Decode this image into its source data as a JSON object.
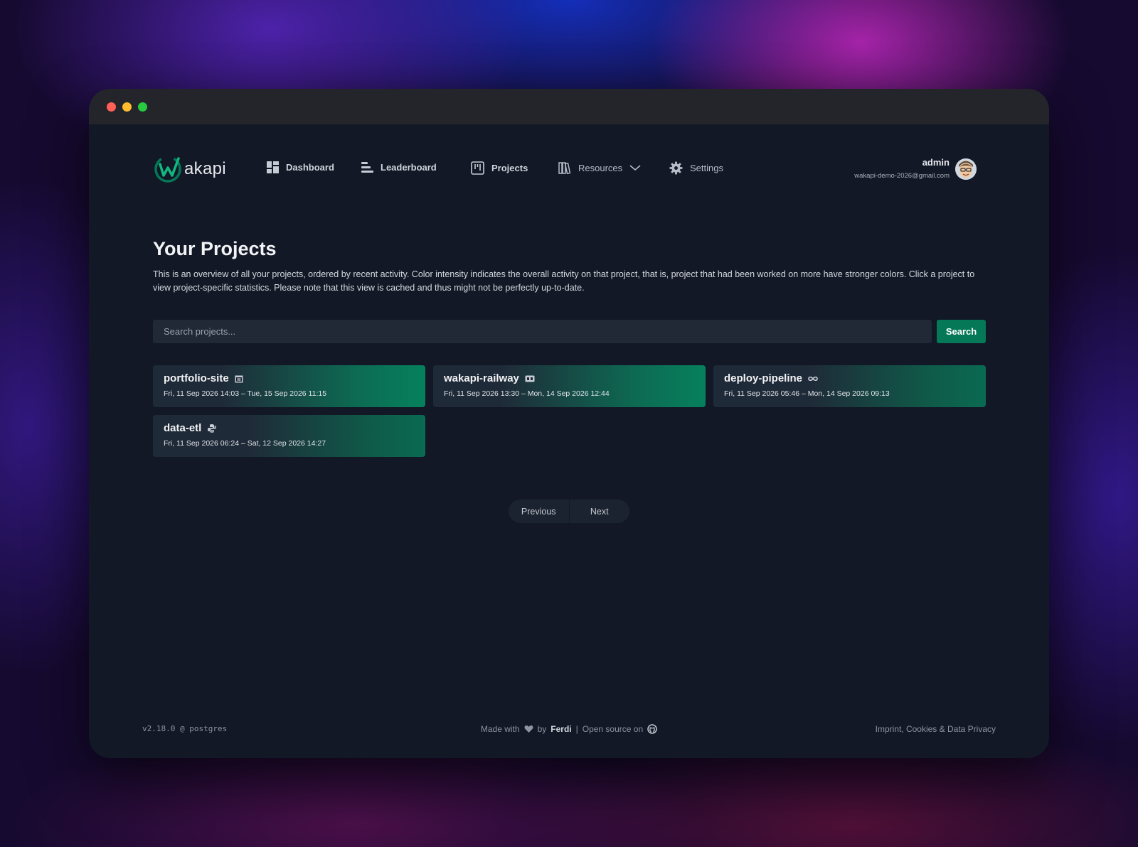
{
  "app": {
    "logo_text": "akapi"
  },
  "nav": {
    "dashboard": "Dashboard",
    "leaderboard": "Leaderboard",
    "projects": "Projects",
    "resources": "Resources",
    "settings": "Settings"
  },
  "user": {
    "name": "admin",
    "email": "wakapi-demo-2026@gmail.com"
  },
  "page": {
    "title": "Your Projects",
    "description": "This is an overview of all your projects, ordered by recent activity. Color intensity indicates the overall activity on that project, that is, project that had been worked on more have stronger colors. Click a project to view project-specific statistics. Please note that this view is cached and thus might not be perfectly up-to-date."
  },
  "search": {
    "placeholder": "Search projects...",
    "button": "Search"
  },
  "projects": [
    {
      "name": "portfolio-site",
      "range": "Fri, 11 Sep 2026 14:03 – Tue, 15 Sep 2026 11:15",
      "icon": "calendar-icon"
    },
    {
      "name": "wakapi-railway",
      "range": "Fri, 11 Sep 2026 13:30 – Mon, 14 Sep 2026 12:44",
      "icon": "terminal-icon"
    },
    {
      "name": "deploy-pipeline",
      "range": "Fri, 11 Sep 2026 05:46 – Mon, 14 Sep 2026 09:13",
      "icon": "infinity-icon"
    },
    {
      "name": "data-etl",
      "range": "Fri, 11 Sep 2026 06:24 – Sat, 12 Sep 2026 14:27",
      "icon": "python-icon"
    }
  ],
  "pagination": {
    "previous": "Previous",
    "next": "Next"
  },
  "footer": {
    "version": "v2.18.0 @ postgres",
    "made_with": "Made with",
    "by": "by",
    "author": "Ferdi",
    "separator": "|",
    "open_source": "Open source on",
    "imprint": "Imprint, Cookies & Data Privacy"
  },
  "colors": {
    "accent": "#047857",
    "background": "#121826",
    "titlebar": "#24252a"
  }
}
